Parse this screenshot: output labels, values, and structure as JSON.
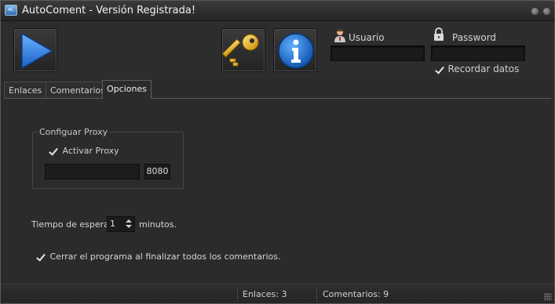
{
  "window": {
    "title": "AutoComent - Versión Registrada!"
  },
  "toolbar": {
    "play_icon": "play-icon",
    "key_icon": "key-icon",
    "info_icon": "info-icon"
  },
  "login": {
    "user_label": "Usuario",
    "user_value": "",
    "password_label": "Password",
    "password_value": "",
    "remember_label": "Recordar datos",
    "remember_checked": true
  },
  "tabs": [
    {
      "label": "Enlaces",
      "active": false
    },
    {
      "label": "Comentarios",
      "active": false
    },
    {
      "label": "Opciones",
      "active": true
    }
  ],
  "options": {
    "proxy_group_title": "Configuar Proxy",
    "activate_proxy_label": "Activar Proxy",
    "activate_proxy_checked": true,
    "proxy_host": "",
    "proxy_port": "8080",
    "timeout_label": "Tiempo de espera:",
    "timeout_value": "1",
    "timeout_unit": "minutos.",
    "close_label": "Cerrar el programa al finalizar todos los comentarios.",
    "close_checked": true
  },
  "status": {
    "links": "Enlaces: 3",
    "comments": "Comentarios: 9"
  },
  "colors": {
    "background": "#2b2b2b",
    "play_blue": "#2f7fe6",
    "key_gold": "#f2c21a",
    "info_blue": "#1f7ad6"
  }
}
